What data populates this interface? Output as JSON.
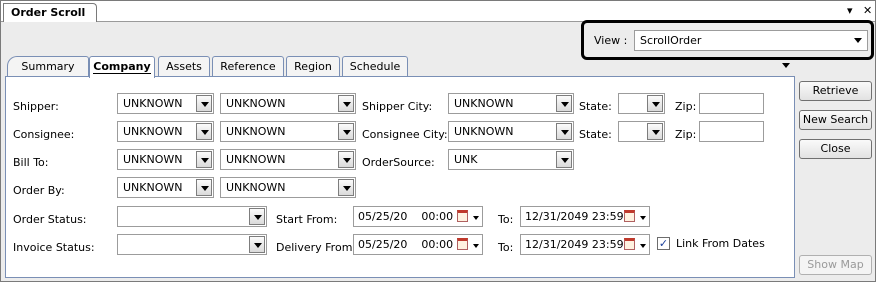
{
  "window": {
    "title": "Order Scroll",
    "pin_glyph": "▾",
    "close_glyph": "✕"
  },
  "view": {
    "label": "View :",
    "value": "ScrollOrder"
  },
  "tabs": [
    {
      "label": "Summary"
    },
    {
      "label": "Company"
    },
    {
      "label": "Assets"
    },
    {
      "label": "Reference"
    },
    {
      "label": "Region"
    },
    {
      "label": "Schedule"
    }
  ],
  "form": {
    "shipper": {
      "label": "Shipper:",
      "id": "UNKNOWN",
      "name": "UNKNOWN"
    },
    "consignee": {
      "label": "Consignee:",
      "id": "UNKNOWN",
      "name": "UNKNOWN"
    },
    "bill_to": {
      "label": "Bill To:",
      "id": "UNKNOWN",
      "name": "UNKNOWN"
    },
    "order_by": {
      "label": "Order By:",
      "id": "UNKNOWN",
      "name": "UNKNOWN"
    },
    "shipper_city": {
      "label": "Shipper City:",
      "value": "UNKNOWN"
    },
    "consignee_city": {
      "label": "Consignee City:",
      "value": "UNKNOWN"
    },
    "order_source": {
      "label": "OrderSource:",
      "value": "UNK"
    },
    "state_label": "State:",
    "zip_label": "Zip:",
    "order_status": {
      "label": "Order Status:",
      "value": ""
    },
    "invoice_status": {
      "label": "Invoice Status:",
      "value": ""
    },
    "start_from": {
      "label": "Start From:",
      "from": "05/25/20    00:00",
      "to_label": "To:",
      "to": "12/31/2049 23:59"
    },
    "delivery_from": {
      "label": "Delivery From:",
      "from": "05/25/20    00:00",
      "to_label": "To:",
      "to": "12/31/2049 23:59"
    },
    "link_dates": {
      "label": "Link From Dates",
      "checked": true,
      "mark": "✓"
    }
  },
  "buttons": {
    "retrieve": "Retrieve",
    "new_search": "New Search",
    "close": "Close",
    "show_map": "Show Map"
  },
  "colors": {
    "tab_border": "#7a8fb5",
    "highlight_border": "#000000"
  }
}
